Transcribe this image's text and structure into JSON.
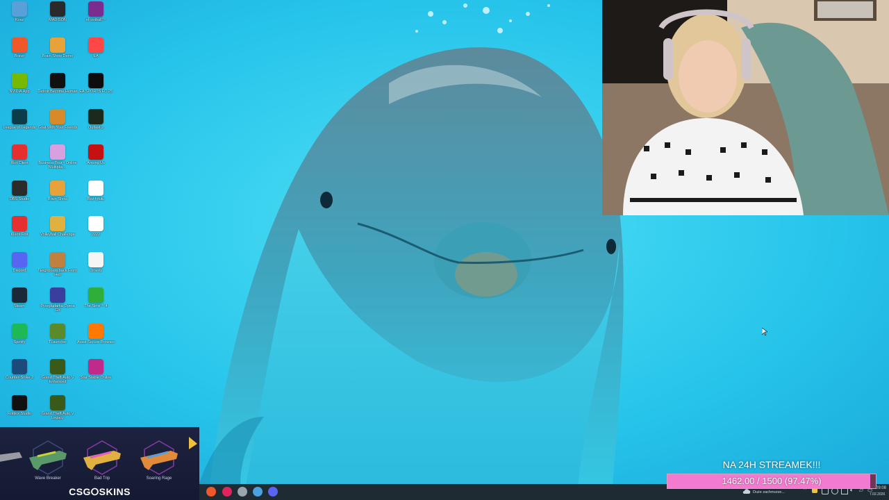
{
  "desktop_icons": [
    {
      "label": "Kosz",
      "icon": "recycle-bin-icon",
      "color": "#5aa0d8"
    },
    {
      "label": "MADISON",
      "icon": "madison-icon",
      "color": "#2a2a2a"
    },
    {
      "label": "eFootball™",
      "icon": "efootball-icon",
      "color": "#7b2d8f"
    },
    {
      "label": "Brave",
      "icon": "brave-icon",
      "color": "#f0582a"
    },
    {
      "label": "Brain Show Demo",
      "icon": "brain-show-icon",
      "color": "#e8a23a"
    },
    {
      "label": "EA",
      "icon": "ea-icon",
      "color": "#ff4747"
    },
    {
      "label": "NVIDIA App",
      "icon": "nvidia-icon",
      "color": "#76b900"
    },
    {
      "label": "Detroit Become Human",
      "icon": "detroit-icon",
      "color": "#101010"
    },
    {
      "label": "EA SPORTS FC 25",
      "icon": "fc25-icon",
      "color": "#0d0d0d"
    },
    {
      "label": "League of Legends",
      "icon": "lol-icon",
      "color": "#0a3c4a"
    },
    {
      "label": "Goat With Your Friends",
      "icon": "goat-icon",
      "color": "#d8892a"
    },
    {
      "label": "Outlast 2",
      "icon": "outlast-icon",
      "color": "#1c2a1c"
    },
    {
      "label": "Riot Client",
      "icon": "riot-icon",
      "color": "#e63030"
    },
    {
      "label": "Business Tour - Online Multiplay...",
      "icon": "business-tour-icon",
      "color": "#d9a0e0"
    },
    {
      "label": "Among Us",
      "icon": "among-us-icon",
      "color": "#c51111"
    },
    {
      "label": "OBS Studio",
      "icon": "obs-icon",
      "color": "#2b2b2b"
    },
    {
      "label": "Brain Show",
      "icon": "brain-show-icon",
      "color": "#e8a23a"
    },
    {
      "label": "Bez tytułu",
      "icon": "blank-file-icon",
      "color": "#ffffff"
    },
    {
      "label": "Klient Riot",
      "icon": "riot-icon",
      "color": "#e63030"
    },
    {
      "label": "Volleyball Challenge",
      "icon": "volleyball-icon",
      "color": "#e0b040"
    },
    {
      "label": "2222",
      "icon": "text-file-icon",
      "color": "#ffffff"
    },
    {
      "label": "Discord",
      "icon": "discord-icon",
      "color": "#5865f2"
    },
    {
      "label": "Neighbours back From Hell",
      "icon": "neighbours-icon",
      "color": "#c08040"
    },
    {
      "label": "Omerty",
      "icon": "omerty-icon",
      "color": "#f5f5f5"
    },
    {
      "label": "Steam",
      "icon": "steam-icon",
      "color": "#1b2838"
    },
    {
      "label": "Przeglądarka Opera GX",
      "icon": "opera-gx-icon",
      "color": "#3a3f9e"
    },
    {
      "label": "The Sims™ 4",
      "icon": "sims-icon",
      "color": "#2fae3a"
    },
    {
      "label": "Spotify",
      "icon": "spotify-icon",
      "color": "#1db954"
    },
    {
      "label": "TLauncher",
      "icon": "tlauncher-icon",
      "color": "#5a8a2a"
    },
    {
      "label": "Avast Secure Browser",
      "icon": "avast-icon",
      "color": "#ff7800"
    },
    {
      "label": "Counter-Strike 2",
      "icon": "cs2-icon",
      "color": "#1c4a7a"
    },
    {
      "label": "Grand Theft Auto V Enhanced",
      "icon": "gta-icon",
      "color": "#3a5a1a"
    },
    {
      "label": "Star Stable Online",
      "icon": "star-stable-icon",
      "color": "#c02a8a"
    },
    {
      "label": "Roblox Studio",
      "icon": "roblox-icon",
      "color": "#111111"
    },
    {
      "label": "Grand Theft Auto V Legacy",
      "icon": "gta-icon",
      "color": "#3a5a1a"
    }
  ],
  "skins_widget": {
    "brand": "CSG⭘SKINS",
    "skins": [
      {
        "name": "Wave Breaker"
      },
      {
        "name": "Bad Trip"
      },
      {
        "name": "Soaring Rage"
      }
    ]
  },
  "subgoal": {
    "title": "NA 24H STREAMEK!!!",
    "progress_text": "1462.00 / 1500 (97.47%)",
    "progress": 0.9747,
    "fill_color": "#f27bd0"
  },
  "taskbar": {
    "apps": [
      {
        "icon": "brave-icon",
        "color": "#f0582a"
      },
      {
        "icon": "opera-gx-icon",
        "color": "#e0245e"
      },
      {
        "icon": "settings-icon",
        "color": "#9aa4ad"
      },
      {
        "icon": "chrome-icon",
        "color": "#4aa3df"
      },
      {
        "icon": "discord-icon",
        "color": "#5865f2"
      }
    ],
    "weather": "Duże zachmurze...",
    "time": "09:08",
    "date": "7.02.2026"
  }
}
